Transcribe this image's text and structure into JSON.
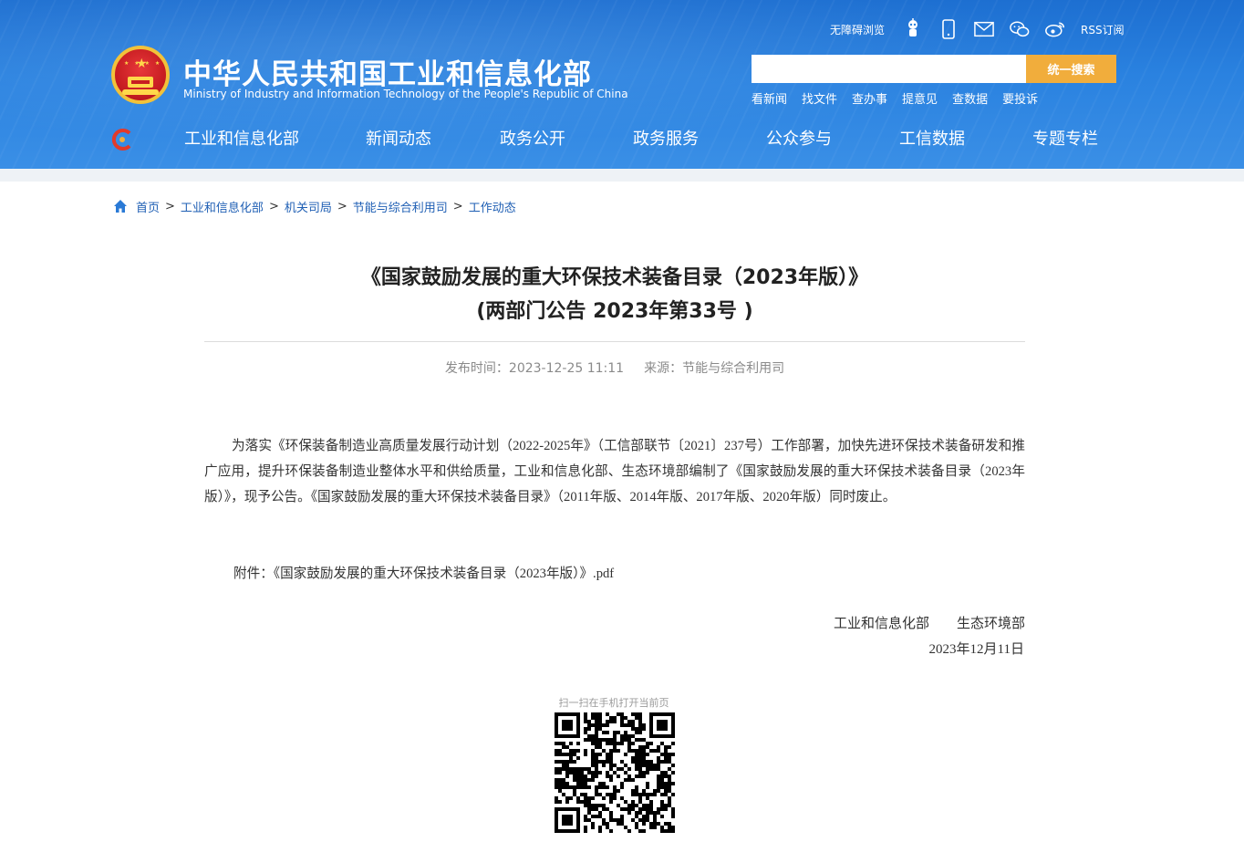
{
  "header": {
    "site_title": "中华人民共和国工业和信息化部",
    "site_subtitle": "Ministry of Industry and Information Technology of the People's Republic of China",
    "accessibility_label": "无障碍浏览",
    "rss_label": "RSS订阅",
    "icons": [
      "robot-icon",
      "mobile-icon",
      "mail-icon",
      "wechat-icon",
      "weibo-icon"
    ],
    "search": {
      "placeholder": "",
      "button_label": "统一搜索"
    },
    "quick_links": [
      "看新闻",
      "找文件",
      "查办事",
      "提意见",
      "查数据",
      "要投诉"
    ],
    "nav": [
      "工业和信息化部",
      "新闻动态",
      "政务公开",
      "政务服务",
      "公众参与",
      "工信数据",
      "专题专栏"
    ]
  },
  "breadcrumb": [
    "首页",
    "工业和信息化部",
    "机关司局",
    "节能与综合利用司",
    "工作动态"
  ],
  "article": {
    "title_line1": "《国家鼓励发展的重大环保技术装备目录（2023年版）》",
    "title_line2": "(两部门公告 2023年第33号 )",
    "publish_label": "发布时间：",
    "publish_time": "2023-12-25 11:11",
    "source_label": "来源：",
    "source": "节能与综合利用司",
    "body": "为落实《环保装备制造业高质量发展行动计划（2022-2025年》（工信部联节〔2021〕237号）工作部署，加快先进环保技术装备研发和推广应用，提升环保装备制造业整体水平和供给质量，工业和信息化部、生态环境部编制了《国家鼓励发展的重大环保技术装备目录（2023年版）》，现予公告。《国家鼓励发展的重大环保技术装备目录》（2011年版、2014年版、2017年版、2020年版）同时废止。",
    "attachment_label": "附件：",
    "attachment_name": "《国家鼓励发展的重大环保技术装备目录（2023年版）》.pdf",
    "signer1": "工业和信息化部",
    "signer2": "生态环境部",
    "sign_date": "2023年12月11日"
  },
  "qr": {
    "caption": "扫一扫在手机打开当前页"
  },
  "colors": {
    "header_blue": "#2a82e0",
    "search_button": "#f1ad3c",
    "link_blue": "#1f5fb4"
  }
}
